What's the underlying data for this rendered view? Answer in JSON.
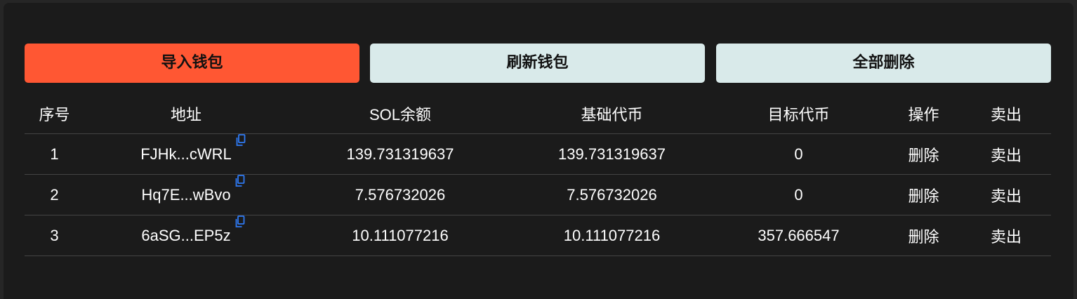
{
  "toolbar": {
    "import_label": "导入钱包",
    "refresh_label": "刷新钱包",
    "delete_all_label": "全部删除"
  },
  "table": {
    "headers": {
      "index": "序号",
      "address": "地址",
      "sol_balance": "SOL余额",
      "base_token": "基础代币",
      "target_token": "目标代币",
      "actions": "操作",
      "sell": "卖出"
    },
    "rows": [
      {
        "index": "1",
        "address": "FJHk...cWRL",
        "sol_balance": "139.731319637",
        "base_token": "139.731319637",
        "target_token": "0",
        "delete_label": "删除",
        "sell_label": "卖出"
      },
      {
        "index": "2",
        "address": "Hq7E...wBvo",
        "sol_balance": "7.576732026",
        "base_token": "7.576732026",
        "target_token": "0",
        "delete_label": "删除",
        "sell_label": "卖出"
      },
      {
        "index": "3",
        "address": "6aSG...EP5z",
        "sol_balance": "10.111077216",
        "base_token": "10.111077216",
        "target_token": "357.666547",
        "delete_label": "删除",
        "sell_label": "卖出"
      }
    ]
  },
  "icons": {
    "copy": "copy-icon"
  },
  "colors": {
    "background": "#1b1b1b",
    "import_button": "#ff5733",
    "secondary_button": "#d9eaea",
    "copy_icon": "#2f7bf6",
    "divider": "#444444"
  }
}
